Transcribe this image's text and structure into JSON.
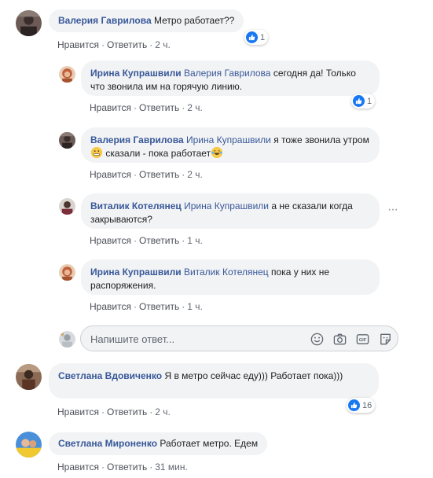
{
  "comments": [
    {
      "author": "Валерия Гаврилова",
      "mention": "",
      "text": "Метро работает??",
      "like": "Нравится",
      "reply": "Ответить",
      "time": "2 ч.",
      "reactions": "1"
    },
    {
      "author": "Ирина Купрашвили",
      "mention": "Валерия Гаврилова",
      "text": "сегодня да! Только что звонила им на горячую линию.",
      "like": "Нравится",
      "reply": "Ответить",
      "time": "2 ч.",
      "reactions": "1"
    },
    {
      "author": "Валерия Гаврилова",
      "mention": "Ирина Купрашвили",
      "text_part1": "я тоже звонила утром",
      "text_part2": "сказали - пока работает",
      "like": "Нравится",
      "reply": "Ответить",
      "time": "2 ч."
    },
    {
      "author": "Виталик Котелянец",
      "mention": "Ирина Купрашвили",
      "text": "а не сказали когда закрываются?",
      "like": "Нравится",
      "reply": "Ответить",
      "time": "1 ч."
    },
    {
      "author": "Ирина Купрашвили",
      "mention": "Виталик Котелянец",
      "text": "пока у них не распоряжения.",
      "like": "Нравится",
      "reply": "Ответить",
      "time": "1 ч."
    },
    {
      "author": "Светлана Вдовиченко",
      "mention": "",
      "text": "Я в метро сейчас еду))) Работает пока)))",
      "like": "Нравится",
      "reply": "Ответить",
      "time": "2 ч.",
      "reactions": "16"
    },
    {
      "author": "Светлана Мироненко",
      "mention": "",
      "text": "Работает метро. Едем",
      "like": "Нравится",
      "reply": "Ответить",
      "time": "31 мин."
    }
  ],
  "reply_box": {
    "placeholder": "Напишите ответ..."
  },
  "colors": {
    "author": "#385898",
    "bubble": "#f2f3f5",
    "like_blue": "#1877f2"
  }
}
